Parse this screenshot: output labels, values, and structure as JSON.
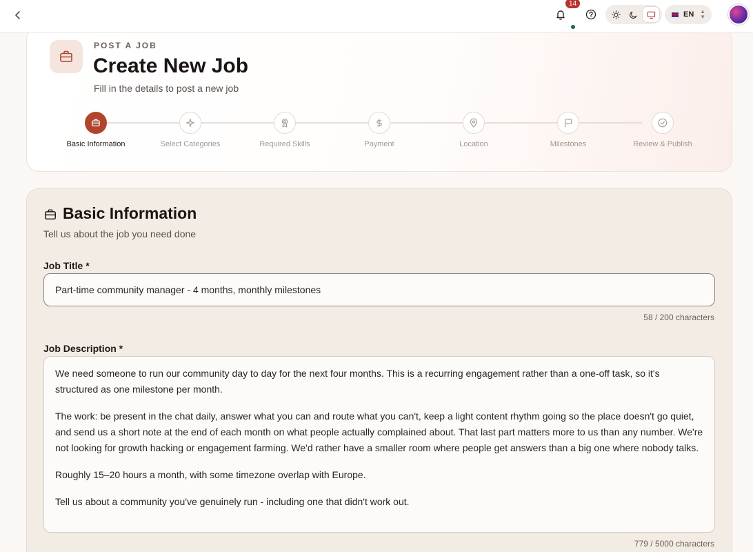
{
  "topbar": {
    "back_icon": "chevron-left-icon",
    "notifications_count": "14",
    "help_icon": "help-circle-icon",
    "theme_options": [
      "light",
      "dark",
      "system"
    ],
    "theme_selected": "system",
    "language": "EN",
    "accent_color": "#b0452c"
  },
  "header": {
    "eyebrow": "POST A JOB",
    "title": "Create New Job",
    "subtitle": "Fill in the details to post a new job"
  },
  "steps": [
    {
      "label": "Basic Information",
      "icon": "briefcase-icon",
      "active": true
    },
    {
      "label": "Select Categories",
      "icon": "sparkles-icon",
      "active": false
    },
    {
      "label": "Required Skills",
      "icon": "award-icon",
      "active": false
    },
    {
      "label": "Payment",
      "icon": "dollar-icon",
      "active": false
    },
    {
      "label": "Location",
      "icon": "map-pin-icon",
      "active": false
    },
    {
      "label": "Milestones",
      "icon": "flag-icon",
      "active": false
    },
    {
      "label": "Review & Publish",
      "icon": "check-circle-icon",
      "active": false
    }
  ],
  "form": {
    "section_title": "Basic Information",
    "section_subtitle": "Tell us about the job you need done",
    "job_title_label": "Job Title *",
    "job_title_value": "Part-time community manager - 4 months, monthly milestones",
    "job_title_counter": "58 / 200 characters",
    "job_description_label": "Job Description *",
    "job_description_paragraphs": [
      "We need someone to run our community day to day for the next four months. This is a recurring engagement rather than a one-off task, so it's structured as one milestone per month.",
      "The work: be present in the chat daily, answer what you can and route what you can't, keep a light content rhythm going so the place doesn't go quiet, and send us a short note at the end of each month on what people actually complained about. That last part matters more to us than any number. We're not looking for growth hacking or engagement farming. We'd rather have a smaller room where people get answers than a big one where nobody talks.",
      "Roughly 15–20 hours a month, with some timezone overlap with Europe.",
      "Tell us about a community you've genuinely run - including one that didn't work out."
    ],
    "job_description_counter": "779 / 5000 characters"
  }
}
